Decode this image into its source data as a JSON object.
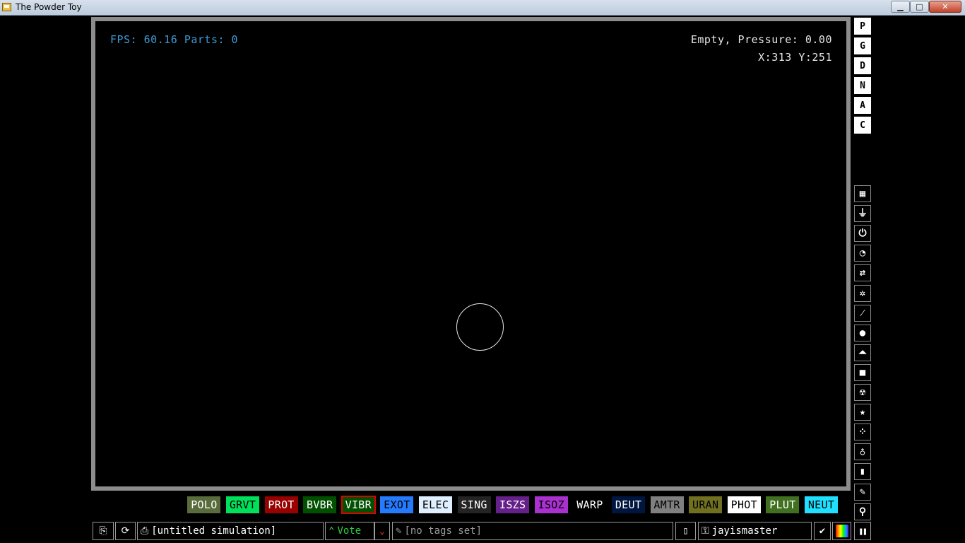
{
  "window": {
    "title": "The Powder Toy",
    "min_glyph": "▁",
    "max_glyph": "□",
    "close_glyph": "✕"
  },
  "hud": {
    "fps": "FPS: 60.16 Parts: 0",
    "pressure": "Empty, Pressure: 0.00",
    "coords": "X:313 Y:251"
  },
  "render_modes": [
    "P",
    "G",
    "D",
    "N",
    "A",
    "C"
  ],
  "categories": [
    {
      "name": "walls",
      "icon": "wall-icon",
      "glyph": "▦"
    },
    {
      "name": "electronics",
      "icon": "plug-icon",
      "glyph": "⏚"
    },
    {
      "name": "powered",
      "icon": "power-icon",
      "glyph": "⏻"
    },
    {
      "name": "sensors",
      "icon": "gauge-icon",
      "glyph": "◔"
    },
    {
      "name": "force",
      "icon": "arrows-icon",
      "glyph": "⇄"
    },
    {
      "name": "explosives",
      "icon": "burst-icon",
      "glyph": "✲"
    },
    {
      "name": "gases",
      "icon": "wand-icon",
      "glyph": "⁄"
    },
    {
      "name": "liquids",
      "icon": "drop-icon",
      "glyph": "●"
    },
    {
      "name": "powders",
      "icon": "powder-icon",
      "glyph": "⏶"
    },
    {
      "name": "solids",
      "icon": "solid-icon",
      "glyph": "■"
    },
    {
      "name": "radioactive",
      "icon": "radiation-icon",
      "glyph": "☢"
    },
    {
      "name": "special",
      "icon": "star-icon",
      "glyph": "★"
    },
    {
      "name": "life",
      "icon": "dots-icon",
      "glyph": "⁘"
    },
    {
      "name": "tools",
      "icon": "bulb-icon",
      "glyph": "♁"
    },
    {
      "name": "favorites",
      "icon": "bookmark-icon",
      "glyph": "▮"
    },
    {
      "name": "decoration",
      "icon": "pen-icon",
      "glyph": "✎"
    },
    {
      "name": "search",
      "icon": "search-icon",
      "glyph": "⚲"
    }
  ],
  "elements": [
    {
      "label": "POLO",
      "bg": "#5a6c3c",
      "fg": "#ffffff"
    },
    {
      "label": "GRVT",
      "bg": "#00e05a",
      "fg": "#000000"
    },
    {
      "label": "PROT",
      "bg": "#990000",
      "fg": "#ffffff"
    },
    {
      "label": "BVBR",
      "bg": "#005000",
      "fg": "#ffffff"
    },
    {
      "label": "VIBR",
      "bg": "#005000",
      "fg": "#ffffff",
      "selected": true
    },
    {
      "label": "EXOT",
      "bg": "#247bfe",
      "fg": "#000000"
    },
    {
      "label": "ELEC",
      "bg": "#dfefff",
      "fg": "#000000"
    },
    {
      "label": "SING",
      "bg": "#242424",
      "fg": "#ffffff"
    },
    {
      "label": "ISZS",
      "bg": "#662089",
      "fg": "#ffffff"
    },
    {
      "label": "ISOZ",
      "bg": "#aa30d0",
      "fg": "#000000"
    },
    {
      "label": "WARP",
      "bg": "#000000",
      "fg": "#ffffff"
    },
    {
      "label": "DEUT",
      "bg": "#00153f",
      "fg": "#ffffff"
    },
    {
      "label": "AMTR",
      "bg": "#808080",
      "fg": "#000000"
    },
    {
      "label": "URAN",
      "bg": "#707020",
      "fg": "#000000"
    },
    {
      "label": "PHOT",
      "bg": "#ffffff",
      "fg": "#000000"
    },
    {
      "label": "PLUT",
      "bg": "#407020",
      "fg": "#ffffff"
    },
    {
      "label": "NEUT",
      "bg": "#20e0ff",
      "fg": "#000000"
    }
  ],
  "bottom": {
    "open_glyph": "⎘",
    "reload_glyph": "⟳",
    "save_glyph": "⎙",
    "save_name": "[untitled simulation]",
    "vote_up_glyph": "⌃",
    "vote_label": "Vote",
    "vote_down_glyph": "⌄",
    "tag_glyph": "✎",
    "tags": "[no tags set]",
    "new_glyph": "▯",
    "login_glyph": "⚿",
    "username": "jayismaster",
    "settings_glyph": "✔",
    "pause_glyph": "❚❚"
  },
  "colors": {
    "fps": "#3e9bd6",
    "selected_outline": "#e00000",
    "vote_up": "#2ecc40",
    "vote_down": "#cc2a1a"
  }
}
